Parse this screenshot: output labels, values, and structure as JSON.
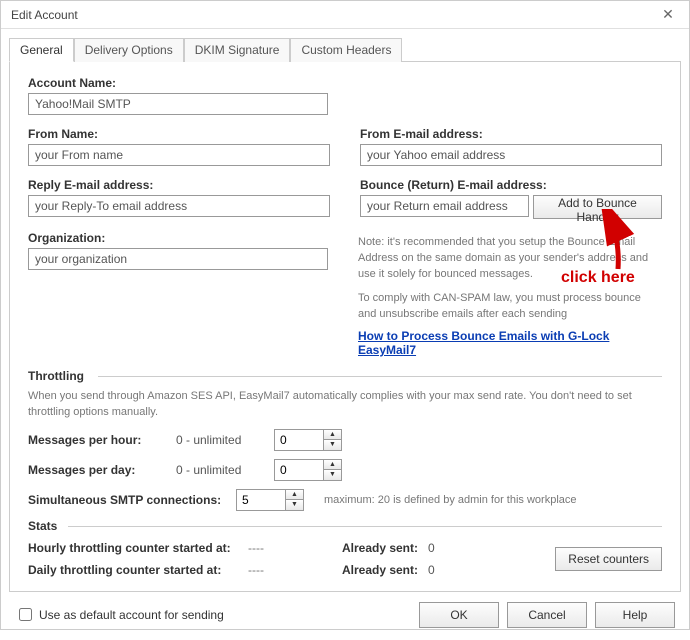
{
  "window": {
    "title": "Edit Account"
  },
  "tabs": {
    "general": "General",
    "delivery": "Delivery Options",
    "dkim": "DKIM Signature",
    "headers": "Custom Headers"
  },
  "labels": {
    "account_name": "Account Name:",
    "from_name": "From Name:",
    "from_email": "From E-mail address:",
    "reply_email": "Reply E-mail address:",
    "bounce_email": "Bounce (Return) E-mail address:",
    "organization": "Organization:",
    "throttling": "Throttling",
    "msg_per_hour": "Messages per hour:",
    "msg_per_day": "Messages per day:",
    "smtp_conn": "Simultaneous SMTP connections:",
    "stats": "Stats",
    "hourly_counter": "Hourly throttling counter started at:",
    "daily_counter": "Daily throttling counter started at:",
    "already_sent": "Already sent:",
    "use_default": "Use as default account for sending"
  },
  "values": {
    "account_name": "Yahoo!Mail SMTP",
    "from_name": "your From name",
    "from_email": "your Yahoo email address",
    "reply_email": "your Reply-To email address",
    "bounce_email": "your Return email address",
    "organization": "your organization",
    "msg_per_hour": "0",
    "msg_per_day": "0",
    "smtp_conn": "5",
    "unlimited": "0 - unlimited",
    "hourly_started": "----",
    "daily_started": "----",
    "already_sent_hourly": "0",
    "already_sent_daily": "0"
  },
  "buttons": {
    "add_bounce": "Add to Bounce Handler",
    "reset_counters": "Reset counters",
    "ok": "OK",
    "cancel": "Cancel",
    "help": "Help"
  },
  "notes": {
    "bounce1": "Note: it's recommended that you setup the Bounce Email Address on the same domain as your sender's address and use it solely for bounced messages.",
    "bounce2": "To comply with CAN-SPAM law, you must process bounce and unsubscribe emails after each sending",
    "throttling_desc": "When you send through Amazon SES API, EasyMail7 automatically complies with your max send rate. You don't need to set throttling options manually.",
    "max_conn": "maximum: 20 is defined by admin for this workplace"
  },
  "link": {
    "bounce_howto": "How to Process Bounce Emails with G-Lock EasyMail7"
  },
  "annotation": {
    "click_here": "click here"
  }
}
